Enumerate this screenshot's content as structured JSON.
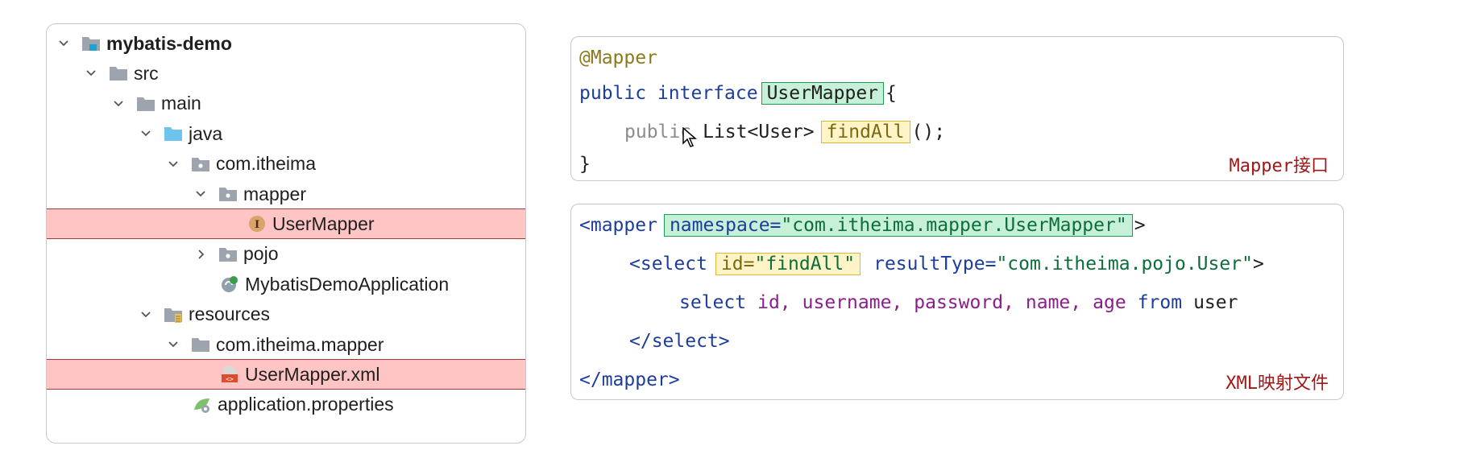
{
  "tree": {
    "items": [
      {
        "label": "mybatis-demo",
        "level": 0,
        "expanded": true,
        "icon": "module-folder-icon",
        "bold": true
      },
      {
        "label": "src",
        "level": 1,
        "expanded": true,
        "icon": "folder-icon"
      },
      {
        "label": "main",
        "level": 2,
        "expanded": true,
        "icon": "folder-icon"
      },
      {
        "label": "java",
        "level": 3,
        "expanded": true,
        "icon": "source-folder-icon"
      },
      {
        "label": "com.itheima",
        "level": 4,
        "expanded": true,
        "icon": "package-icon"
      },
      {
        "label": "mapper",
        "level": 5,
        "expanded": true,
        "icon": "package-icon"
      },
      {
        "label": "UserMapper",
        "level": 7,
        "icon": "interface-icon",
        "selected": true
      },
      {
        "label": "pojo",
        "level": 5,
        "expanded": false,
        "icon": "package-icon"
      },
      {
        "label": "MybatisDemoApplication",
        "level": 6,
        "icon": "spring-app-icon"
      },
      {
        "label": "resources",
        "level": 3,
        "expanded": true,
        "icon": "resources-folder-icon"
      },
      {
        "label": "com.itheima.mapper",
        "level": 4,
        "expanded": true,
        "icon": "folder-icon"
      },
      {
        "label": "UserMapper.xml",
        "level": 6,
        "icon": "xml-file-icon",
        "selected": true
      },
      {
        "label": "application.properties",
        "level": 5,
        "icon": "properties-file-icon"
      }
    ]
  },
  "mapper_interface": {
    "annotation": "@Mapper",
    "decl_kw": "public interface",
    "interface_name": "UserMapper",
    "open_brace": "{",
    "method_kw": "public",
    "method_return": "List<User>",
    "method_name": "findAll",
    "method_tail": "();",
    "close_brace": "}",
    "caption": "Mapper接口"
  },
  "xml_mapping": {
    "mapper_open": "<mapper",
    "namespace_attr": "namespace=",
    "namespace_value": "\"com.itheima.mapper.UserMapper\"",
    "mapper_open_end": ">",
    "select_open": "<select",
    "id_attr": "id=",
    "id_value": "\"findAll\"",
    "result_attr": "resultType=",
    "result_value": "\"com.itheima.pojo.User\"",
    "select_open_end": ">",
    "sql_select": "select",
    "sql_id": "id,",
    "sql_username": "username,",
    "sql_password": "password,",
    "sql_name": "name,",
    "sql_age": "age",
    "sql_from": "from",
    "sql_table": "user",
    "select_close": "</select>",
    "mapper_close": "</mapper>",
    "caption": "XML映射文件"
  },
  "colors": {
    "highlight_green": "#c7f0d8",
    "highlight_yellow": "#fff3c8",
    "selection_red": "#ffc4c4",
    "caption_red": "#a01818",
    "keyword_blue": "#1d3d9c"
  }
}
